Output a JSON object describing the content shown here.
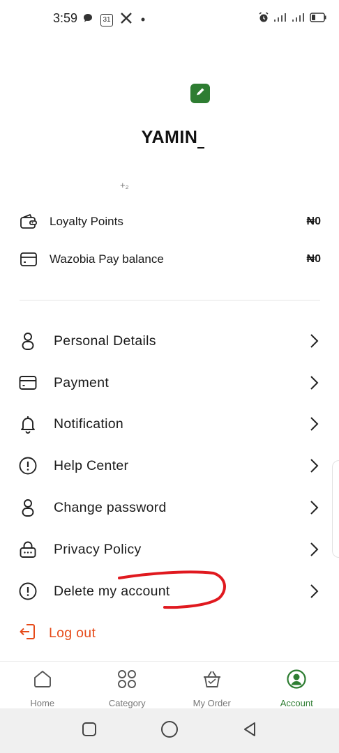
{
  "status_bar": {
    "time": "3:59",
    "left_icons": [
      "chat-bubble-icon",
      "calendar-icon",
      "x-logo-icon",
      "dot-icon"
    ],
    "calendar_day": "31",
    "right_icons": [
      "alarm-icon",
      "signal-icon",
      "signal-icon",
      "battery-icon"
    ]
  },
  "profile": {
    "name": "YAMIN",
    "small_mark": "+₂"
  },
  "balances": [
    {
      "icon": "wallet-icon",
      "label": "Loyalty Points",
      "value": "₦0"
    },
    {
      "icon": "card-icon",
      "label": "Wazobia Pay balance",
      "value": "₦0"
    }
  ],
  "menu": [
    {
      "icon": "person-icon",
      "label": "Personal Details"
    },
    {
      "icon": "card-icon",
      "label": "Payment"
    },
    {
      "icon": "bell-icon",
      "label": "Notification"
    },
    {
      "icon": "info-circle-icon",
      "label": "Help Center"
    },
    {
      "icon": "person-icon",
      "label": "Change password"
    },
    {
      "icon": "lock-icon",
      "label": "Privacy Policy"
    },
    {
      "icon": "info-circle-icon",
      "label": "Delete my account"
    }
  ],
  "logout": {
    "icon": "logout-icon",
    "label": "Log out"
  },
  "bottom_nav": [
    {
      "icon": "home-icon",
      "label": "Home",
      "active": false
    },
    {
      "icon": "category-icon",
      "label": "Category",
      "active": false
    },
    {
      "icon": "basket-icon",
      "label": "My Order",
      "active": false
    },
    {
      "icon": "account-icon",
      "label": "Account",
      "active": true
    }
  ],
  "system_nav": [
    "recents-icon",
    "home-circle-icon",
    "back-icon"
  ],
  "colors": {
    "brand_green": "#2e7d32",
    "logout_orange": "#e64a19",
    "annotation_red": "#e0191f",
    "text": "#1a1a1a",
    "muted": "#777777"
  }
}
